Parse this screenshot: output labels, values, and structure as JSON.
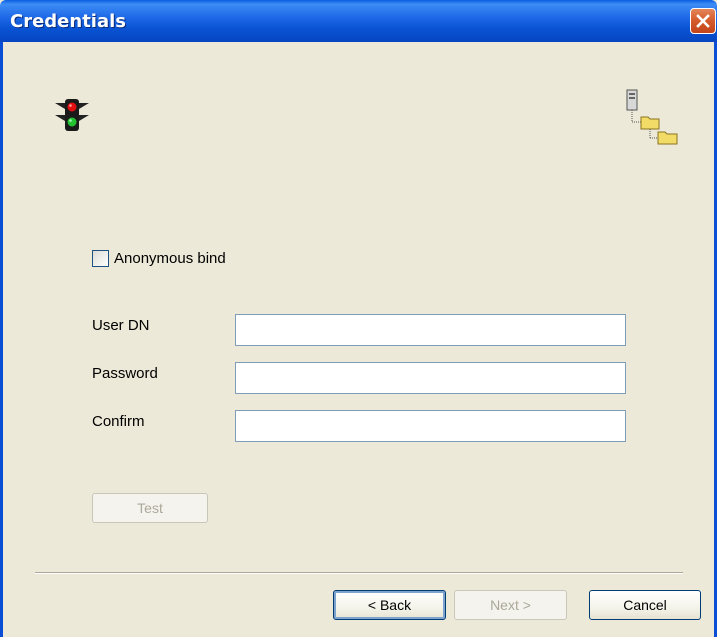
{
  "window": {
    "title": "Credentials"
  },
  "checkbox": {
    "label": "Anonymous bind",
    "checked": false
  },
  "fields": [
    {
      "label": "User DN",
      "value": ""
    },
    {
      "label": "Password",
      "value": ""
    },
    {
      "label": "Confirm",
      "value": ""
    }
  ],
  "buttons": {
    "test": "Test",
    "back": "< Back",
    "next": "Next >",
    "cancel": "Cancel"
  },
  "icons": {
    "header_left": "traffic-light-icon",
    "header_right": "directory-tree-icon",
    "close": "close-icon"
  },
  "colors": {
    "titlebar": "#0852D3",
    "dialog_bg": "#ECE9D8",
    "close_button": "#D45A2B"
  }
}
